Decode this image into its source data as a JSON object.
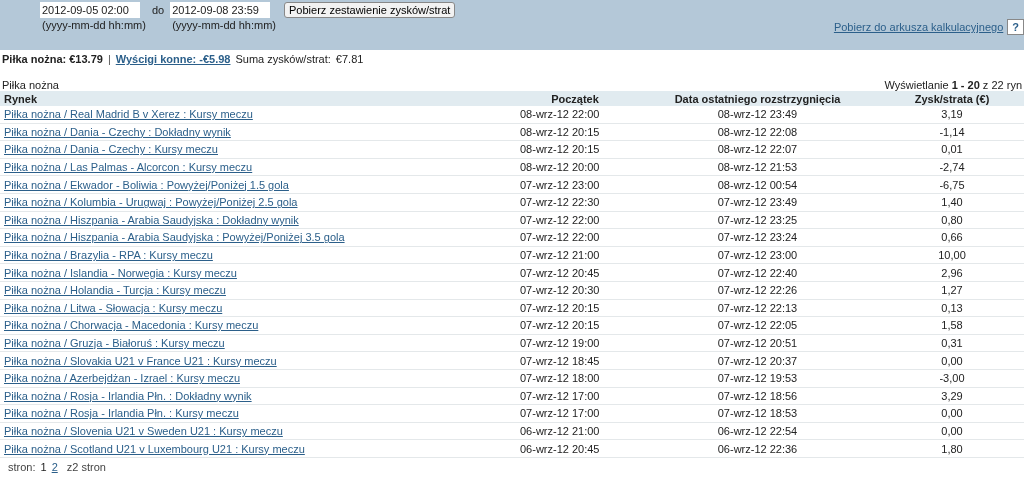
{
  "filter": {
    "from": {
      "value": "2012-09-05 02:00",
      "hint": "(yyyy-mm-dd hh:mm)"
    },
    "to_label": "do",
    "to": {
      "value": "2012-09-08 23:59",
      "hint": "(yyyy-mm-dd hh:mm)"
    },
    "button": "Pobierz zestawienie zysków/strat",
    "export_link": "Pobierz do arkusza kalkulacyjnego",
    "help": "?"
  },
  "summary": {
    "current": "Piłka nożna: €13.79",
    "separator": "|",
    "other": "Wyścigi konne: -€5.98",
    "total_label": "Suma zysków/strat:",
    "total_value": "€7.81"
  },
  "section_title": "Piłka nożna",
  "range_info": "Wyświetlanie **1 - 20** z 22 ryn",
  "table": {
    "columns": [
      "Rynek",
      "Początek",
      "Data ostatniego rozstrzygnięcia",
      "Zysk/strata (€)"
    ],
    "rows": [
      [
        "Piłka nożna / Real Madrid B v Xerez : Kursy meczu",
        "08-wrz-12 22:00",
        "08-wrz-12 23:49",
        "3,19"
      ],
      [
        "Piłka nożna / Dania - Czechy : Dokładny wynik",
        "08-wrz-12 20:15",
        "08-wrz-12 22:08",
        "-1,14"
      ],
      [
        "Piłka nożna / Dania - Czechy : Kursy meczu",
        "08-wrz-12 20:15",
        "08-wrz-12 22:07",
        "0,01"
      ],
      [
        "Piłka nożna / Las Palmas - Alcorcon : Kursy meczu",
        "08-wrz-12 20:00",
        "08-wrz-12 21:53",
        "-2,74"
      ],
      [
        "Piłka nożna / Ekwador - Boliwia : Powyżej/Poniżej 1.5 gola",
        "07-wrz-12 23:00",
        "08-wrz-12 00:54",
        "-6,75"
      ],
      [
        "Piłka nożna / Kolumbia - Urugwaj : Powyżej/Poniżej 2.5 gola",
        "07-wrz-12 22:30",
        "07-wrz-12 23:49",
        "1,40"
      ],
      [
        "Piłka nożna / Hiszpania - Arabia Saudyjska : Dokładny wynik",
        "07-wrz-12 22:00",
        "07-wrz-12 23:25",
        "0,80"
      ],
      [
        "Piłka nożna / Hiszpania - Arabia Saudyjska : Powyżej/Poniżej 3.5 gola",
        "07-wrz-12 22:00",
        "07-wrz-12 23:24",
        "0,66"
      ],
      [
        "Piłka nożna / Brazylia - RPA : Kursy meczu",
        "07-wrz-12 21:00",
        "07-wrz-12 23:00",
        "10,00"
      ],
      [
        "Piłka nożna / Islandia - Norwegia : Kursy meczu",
        "07-wrz-12 20:45",
        "07-wrz-12 22:40",
        "2,96"
      ],
      [
        "Piłka nożna / Holandia - Turcja : Kursy meczu",
        "07-wrz-12 20:30",
        "07-wrz-12 22:26",
        "1,27"
      ],
      [
        "Piłka nożna / Litwa - Słowacja : Kursy meczu",
        "07-wrz-12 20:15",
        "07-wrz-12 22:13",
        "0,13"
      ],
      [
        "Piłka nożna / Chorwacja - Macedonia : Kursy meczu",
        "07-wrz-12 20:15",
        "07-wrz-12 22:05",
        "1,58"
      ],
      [
        "Piłka nożna / Gruzja - Białoruś : Kursy meczu",
        "07-wrz-12 19:00",
        "07-wrz-12 20:51",
        "0,31"
      ],
      [
        "Piłka nożna / Slovakia U21 v France U21 : Kursy meczu",
        "07-wrz-12 18:45",
        "07-wrz-12 20:37",
        "0,00"
      ],
      [
        "Piłka nożna / Azerbejdżan - Izrael : Kursy meczu",
        "07-wrz-12 18:00",
        "07-wrz-12 19:53",
        "-3,00"
      ],
      [
        "Piłka nożna / Rosja - Irlandia Płn. : Dokładny wynik",
        "07-wrz-12 17:00",
        "07-wrz-12 18:56",
        "3,29"
      ],
      [
        "Piłka nożna / Rosja - Irlandia Płn. : Kursy meczu",
        "07-wrz-12 17:00",
        "07-wrz-12 18:53",
        "0,00"
      ],
      [
        "Piłka nożna / Slovenia U21 v Sweden U21 : Kursy meczu",
        "06-wrz-12 21:00",
        "06-wrz-12 22:54",
        "0,00"
      ],
      [
        "Piłka nożna / Scotland U21 v Luxembourg U21 : Kursy meczu",
        "06-wrz-12 20:45",
        "06-wrz-12 22:36",
        "1,80"
      ]
    ]
  },
  "pager": {
    "label": "stron:",
    "pages": [
      {
        "label": "1",
        "selected": true
      },
      {
        "label": "2",
        "selected": false
      }
    ],
    "total": "z2 stron"
  }
}
